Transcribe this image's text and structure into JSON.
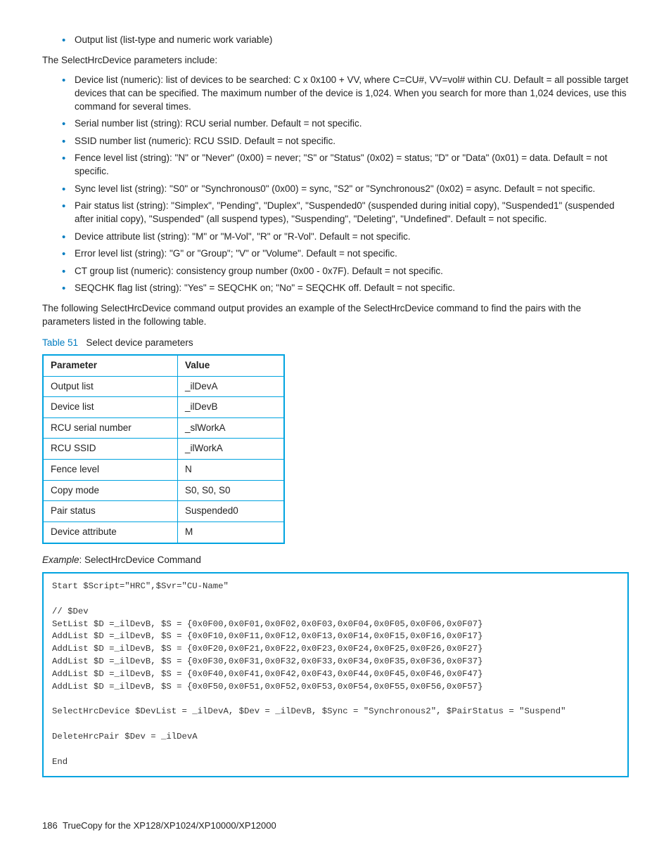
{
  "bullets_top": [
    "Output list (list-type and numeric work variable)"
  ],
  "intro_para": "The SelectHrcDevice parameters include:",
  "bullets_main": [
    "Device list (numeric): list of devices to be searched: C x 0x100 + VV, where C=CU#, VV=vol# within CU. Default = all possible target devices that can be specified. The maximum number of the device is 1,024. When you search for more than 1,024 devices, use this command for several times.",
    "Serial number list (string): RCU serial number. Default = not specific.",
    "SSID number list (numeric): RCU SSID. Default = not specific.",
    "Fence level list (string): \"N\" or \"Never\" (0x00) = never; \"S\" or \"Status\" (0x02) = status; \"D\" or \"Data\" (0x01) = data. Default = not specific.",
    "Sync level list (string): \"S0\" or \"Synchronous0\" (0x00) = sync, \"S2\" or \"Synchronous2\" (0x02) = async. Default = not specific.",
    "Pair status list (string): \"Simplex\", \"Pending\", \"Duplex\", \"Suspended0\" (suspended during initial copy), \"Suspended1\" (suspended after initial copy), \"Suspended\" (all suspend types), \"Suspending\", \"Deleting\", \"Undefined\". Default = not specific.",
    "Device attribute list (string): \"M\" or \"M-Vol\", \"R\" or \"R-Vol\". Default = not specific.",
    "Error level list (string): \"G\" or \"Group\"; \"V\" or \"Volume\". Default = not specific.",
    "CT group list (numeric): consistency group number (0x00 - 0x7F). Default = not specific.",
    "SEQCHK flag list (string): \"Yes\" = SEQCHK on; \"No\" = SEQCHK off. Default = not specific."
  ],
  "following_para": "The following SelectHrcDevice command output provides an example of the SelectHrcDevice command to find the pairs with the parameters listed in the following table.",
  "table": {
    "label": "Table 51",
    "title": "Select device parameters",
    "header": {
      "c1": "Parameter",
      "c2": "Value"
    },
    "rows": [
      {
        "c1": "Output list",
        "c2": "_ilDevA"
      },
      {
        "c1": "Device list",
        "c2": "_ilDevB"
      },
      {
        "c1": "RCU serial number",
        "c2": "_slWorkA"
      },
      {
        "c1": "RCU SSID",
        "c2": "_ilWorkA"
      },
      {
        "c1": "Fence level",
        "c2": "N"
      },
      {
        "c1": "Copy mode",
        "c2": "S0, S0, S0"
      },
      {
        "c1": "Pair status",
        "c2": "Suspended0"
      },
      {
        "c1": "Device attribute",
        "c2": "M"
      }
    ]
  },
  "example": {
    "prefix": "Example",
    "text": ": SelectHrcDevice Command"
  },
  "code": "Start $Script=\"HRC\",$Svr=\"CU-Name\"\n\n// $Dev\nSetList $D =_ilDevB, $S = {0x0F00,0x0F01,0x0F02,0x0F03,0x0F04,0x0F05,0x0F06,0x0F07}\nAddList $D =_ilDevB, $S = {0x0F10,0x0F11,0x0F12,0x0F13,0x0F14,0x0F15,0x0F16,0x0F17}\nAddList $D =_ilDevB, $S = {0x0F20,0x0F21,0x0F22,0x0F23,0x0F24,0x0F25,0x0F26,0x0F27}\nAddList $D =_ilDevB, $S = {0x0F30,0x0F31,0x0F32,0x0F33,0x0F34,0x0F35,0x0F36,0x0F37}\nAddList $D =_ilDevB, $S = {0x0F40,0x0F41,0x0F42,0x0F43,0x0F44,0x0F45,0x0F46,0x0F47}\nAddList $D =_ilDevB, $S = {0x0F50,0x0F51,0x0F52,0x0F53,0x0F54,0x0F55,0x0F56,0x0F57}\n\nSelectHrcDevice $DevList = _ilDevA, $Dev = _ilDevB, $Sync = \"Synchronous2\", $PairStatus = \"Suspend\"\n\nDeleteHrcPair $Dev = _ilDevA\n\nEnd",
  "footer": {
    "page": "186",
    "title": "TrueCopy for the XP128/XP1024/XP10000/XP12000"
  }
}
